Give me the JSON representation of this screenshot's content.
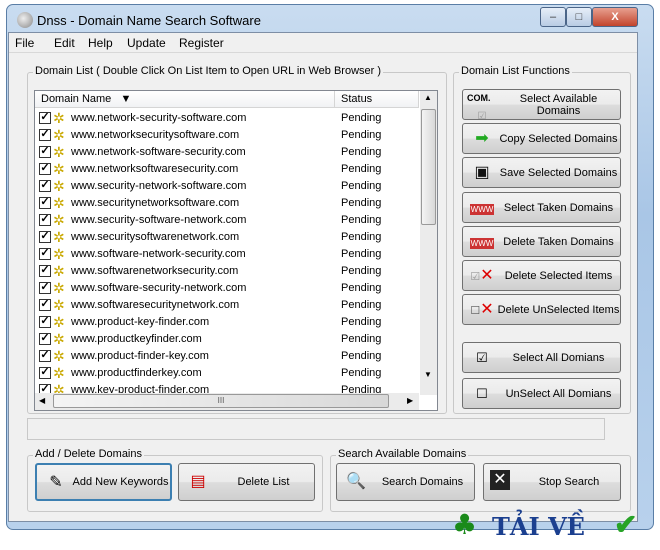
{
  "window": {
    "title": "Dnss - Domain Name Search Software"
  },
  "menu": [
    "File",
    "Edit",
    "Help",
    "Update",
    "Register"
  ],
  "domain_list": {
    "group_label": "Domain List ( Double Click On List Item to Open URL in Web Browser  )",
    "columns": [
      "Domain Name",
      "Status"
    ],
    "rows": [
      {
        "domain": "www.network-security-software.com",
        "status": "Pending"
      },
      {
        "domain": "www.networksecuritysoftware.com",
        "status": "Pending"
      },
      {
        "domain": "www.network-software-security.com",
        "status": "Pending"
      },
      {
        "domain": "www.networksoftwaresecurity.com",
        "status": "Pending"
      },
      {
        "domain": "www.security-network-software.com",
        "status": "Pending"
      },
      {
        "domain": "www.securitynetworksoftware.com",
        "status": "Pending"
      },
      {
        "domain": "www.security-software-network.com",
        "status": "Pending"
      },
      {
        "domain": "www.securitysoftwarenetwork.com",
        "status": "Pending"
      },
      {
        "domain": "www.software-network-security.com",
        "status": "Pending"
      },
      {
        "domain": "www.softwarenetworksecurity.com",
        "status": "Pending"
      },
      {
        "domain": "www.software-security-network.com",
        "status": "Pending"
      },
      {
        "domain": "www.softwaresecuritynetwork.com",
        "status": "Pending"
      },
      {
        "domain": "www.product-key-finder.com",
        "status": "Pending"
      },
      {
        "domain": "www.productkeyfinder.com",
        "status": "Pending"
      },
      {
        "domain": "www.product-finder-key.com",
        "status": "Pending"
      },
      {
        "domain": "www.productfinderkey.com",
        "status": "Pending"
      },
      {
        "domain": "www.key-product-finder.com",
        "status": "Pending"
      }
    ]
  },
  "functions": {
    "group_label": "Domain List Functions",
    "buttons": [
      "Select Available Domains",
      "Copy Selected Domains",
      "Save Selected Domains",
      "Select Taken Domains",
      "Delete Taken Domains",
      "Delete Selected Items",
      "Delete UnSelected Items",
      "Select All Domians",
      "UnSelect All Domians"
    ],
    "icon_text": {
      "com": "COM.",
      "www": "WWW"
    }
  },
  "add_delete": {
    "group_label": "Add / Delete Domains",
    "add": "Add New Keywords",
    "delete": "Delete List"
  },
  "search": {
    "group_label": "Search Available Domains",
    "search": "Search Domains",
    "stop": "Stop Search"
  },
  "watermark": "TẢI VỀ",
  "scroll_grip": "III"
}
